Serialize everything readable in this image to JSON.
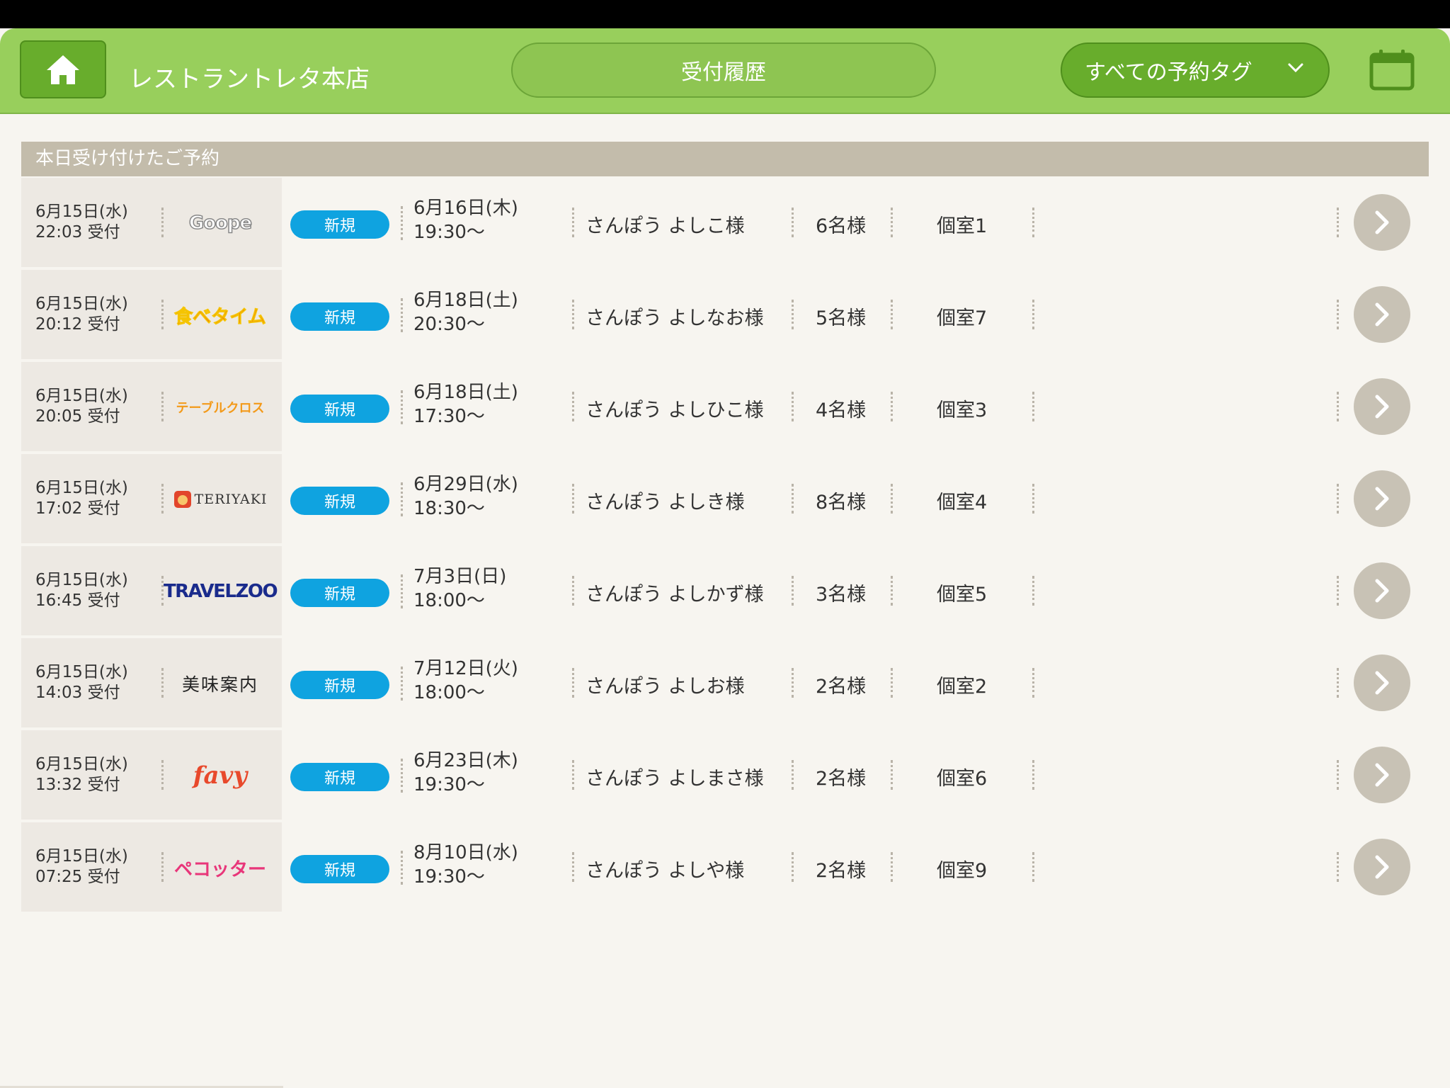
{
  "header": {
    "shop_name": "レストラントレタ本店",
    "history_label": "受付履歴",
    "tag_filter_label": "すべての予約タグ"
  },
  "section": {
    "title": "本日受け付けたご予約"
  },
  "colors": {
    "header_green": "#98cf5c",
    "button_green": "#68ad2c",
    "badge_blue": "#0fa3e0",
    "section_gray": "#c3bcab"
  },
  "reservations": [
    {
      "received_date": "6月15日(水)",
      "received_time": "22:03 受付",
      "source": "Goope",
      "badge": "新規",
      "visit_date": "6月16日(木)",
      "visit_time": "19:30〜",
      "customer": "さんぽう よしこ様",
      "party": "6名様",
      "room": "個室1"
    },
    {
      "received_date": "6月15日(水)",
      "received_time": "20:12 受付",
      "source": "食べタイム",
      "badge": "新規",
      "visit_date": "6月18日(土)",
      "visit_time": "20:30〜",
      "customer": "さんぽう よしなお様",
      "party": "5名様",
      "room": "個室7"
    },
    {
      "received_date": "6月15日(水)",
      "received_time": "20:05 受付",
      "source": "テーブルクロス",
      "badge": "新規",
      "visit_date": "6月18日(土)",
      "visit_time": "17:30〜",
      "customer": "さんぽう よしひこ様",
      "party": "4名様",
      "room": "個室3"
    },
    {
      "received_date": "6月15日(水)",
      "received_time": "17:02 受付",
      "source": "TERIYAKI",
      "badge": "新規",
      "visit_date": "6月29日(水)",
      "visit_time": "18:30〜",
      "customer": "さんぽう よしき様",
      "party": "8名様",
      "room": "個室4"
    },
    {
      "received_date": "6月15日(水)",
      "received_time": "16:45 受付",
      "source": "TRAVELZOO",
      "badge": "新規",
      "visit_date": "7月3日(日)",
      "visit_time": "18:00〜",
      "customer": "さんぽう よしかず様",
      "party": "3名様",
      "room": "個室5"
    },
    {
      "received_date": "6月15日(水)",
      "received_time": "14:03 受付",
      "source": "美味案内",
      "badge": "新規",
      "visit_date": "7月12日(火)",
      "visit_time": "18:00〜",
      "customer": "さんぽう よしお様",
      "party": "2名様",
      "room": "個室2"
    },
    {
      "received_date": "6月15日(水)",
      "received_time": "13:32 受付",
      "source": "favy",
      "badge": "新規",
      "visit_date": "6月23日(木)",
      "visit_time": "19:30〜",
      "customer": "さんぽう よしまさ様",
      "party": "2名様",
      "room": "個室6"
    },
    {
      "received_date": "6月15日(水)",
      "received_time": "07:25 受付",
      "source": "ペコッター",
      "badge": "新規",
      "visit_date": "8月10日(水)",
      "visit_time": "19:30〜",
      "customer": "さんぽう よしや様",
      "party": "2名様",
      "room": "個室9"
    }
  ]
}
